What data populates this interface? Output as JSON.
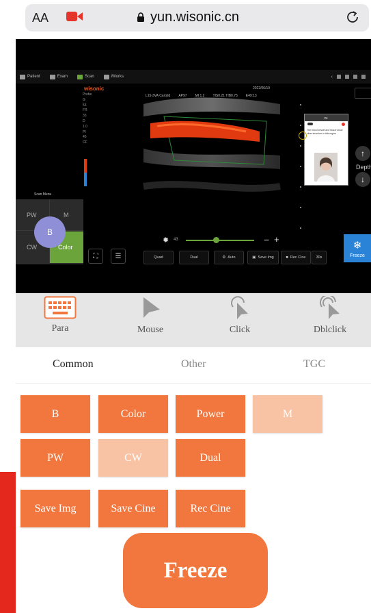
{
  "browser": {
    "text_size_label": "AA",
    "url": "yun.wisonic.cn"
  },
  "viewer": {
    "topbar": [
      {
        "label": "Patient"
      },
      {
        "label": "Exam"
      },
      {
        "label": "Scan"
      },
      {
        "label": "iWorks"
      }
    ],
    "brand": "wisonic",
    "params": [
      "Probe",
      "G",
      "53",
      "FR",
      "33",
      "D",
      "1.0",
      "PI",
      "45",
      "CF"
    ],
    "header": [
      "L15-3VA Carotid",
      "AP97",
      "MI 1.2",
      "TIS0.21 TIB0.75",
      "E49:13"
    ],
    "date": "2022/06/19",
    "scan_menu": "Scan Menu",
    "left_cells": {
      "pw": "PW",
      "m": "M",
      "cw": "CW",
      "color": "Color",
      "b": "B"
    },
    "toolbar": {
      "quad": "Quad",
      "dual": "Dual",
      "auto": "Auto",
      "save_img": "Save Img",
      "rec_cine": "Rec Cine",
      "cine_len": "30s"
    },
    "brightness_value": "43",
    "video_title": "Dr.",
    "video_text": "The blood vessel and tissue show clear structure in this region",
    "depth_label": "Depth",
    "freeze_label": "Freeze",
    "colors": {
      "accent_orange": "#f2773e",
      "color_mode": "#6ba43a",
      "freeze_blue": "#2b83d8",
      "doppler": "#e23a10"
    }
  },
  "modes": [
    {
      "label": "Para",
      "icon": "keyboard-icon"
    },
    {
      "label": "Mouse",
      "icon": "pointer-icon"
    },
    {
      "label": "Click",
      "icon": "click-icon"
    },
    {
      "label": "Dblclick",
      "icon": "double-click-icon"
    }
  ],
  "tabs": [
    {
      "label": "Common",
      "active": true
    },
    {
      "label": "Other",
      "active": false
    },
    {
      "label": "TGC",
      "active": false
    }
  ],
  "buttons": [
    {
      "label": "B",
      "enabled": true
    },
    {
      "label": "Color",
      "enabled": true
    },
    {
      "label": "Power",
      "enabled": true
    },
    {
      "label": "M",
      "enabled": false
    },
    {
      "label": "PW",
      "enabled": true
    },
    {
      "label": "CW",
      "enabled": false
    },
    {
      "label": "Dual",
      "enabled": true
    },
    {
      "label": "Save Img",
      "enabled": true
    },
    {
      "label": "Save Cine",
      "enabled": true
    },
    {
      "label": "Rec Cine",
      "enabled": true
    }
  ],
  "freeze_button": "Freeze"
}
